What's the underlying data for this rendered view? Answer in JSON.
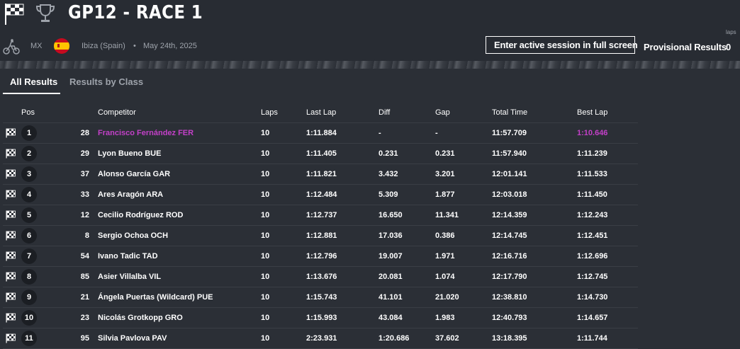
{
  "header": {
    "title": "GP12 - RACE 1",
    "discipline": "MX",
    "location": "Ibiza (Spain)",
    "separator": "•",
    "date": "May 24th, 2025",
    "fullscreen_label": "Enter active session in full screen",
    "provisional_label": "Provisional Results",
    "laps_label": "laps",
    "laps_value": "0"
  },
  "tabs": [
    {
      "label": "All Results",
      "active": true
    },
    {
      "label": "Results by Class",
      "active": false
    }
  ],
  "columns": {
    "pos": "Pos",
    "competitor": "Competitor",
    "laps": "Laps",
    "last_lap": "Last Lap",
    "diff": "Diff",
    "gap": "Gap",
    "total_time": "Total Time",
    "best_lap": "Best Lap"
  },
  "colors": {
    "background": "#2b2f36",
    "highlight": "#c340c8"
  },
  "rows": [
    {
      "pos": "1",
      "num": "28",
      "competitor": "Francisco Fernández FER",
      "laps": "10",
      "last_lap": "1:11.884",
      "diff": "-",
      "gap": "-",
      "total": "11:57.709",
      "best": "1:10.646",
      "highlight": true
    },
    {
      "pos": "2",
      "num": "29",
      "competitor": "Lyon Bueno BUE",
      "laps": "10",
      "last_lap": "1:11.405",
      "diff": "0.231",
      "gap": "0.231",
      "total": "11:57.940",
      "best": "1:11.239"
    },
    {
      "pos": "3",
      "num": "37",
      "competitor": "Alonso García GAR",
      "laps": "10",
      "last_lap": "1:11.821",
      "diff": "3.432",
      "gap": "3.201",
      "total": "12:01.141",
      "best": "1:11.533"
    },
    {
      "pos": "4",
      "num": "33",
      "competitor": "Ares Aragón ARA",
      "laps": "10",
      "last_lap": "1:12.484",
      "diff": "5.309",
      "gap": "1.877",
      "total": "12:03.018",
      "best": "1:11.450"
    },
    {
      "pos": "5",
      "num": "12",
      "competitor": "Cecilio Rodríguez ROD",
      "laps": "10",
      "last_lap": "1:12.737",
      "diff": "16.650",
      "gap": "11.341",
      "total": "12:14.359",
      "best": "1:12.243"
    },
    {
      "pos": "6",
      "num": "8",
      "competitor": "Sergio Ochoa OCH",
      "laps": "10",
      "last_lap": "1:12.881",
      "diff": "17.036",
      "gap": "0.386",
      "total": "12:14.745",
      "best": "1:12.451"
    },
    {
      "pos": "7",
      "num": "54",
      "competitor": "Ivano Tadic TAD",
      "laps": "10",
      "last_lap": "1:12.796",
      "diff": "19.007",
      "gap": "1.971",
      "total": "12:16.716",
      "best": "1:12.696"
    },
    {
      "pos": "8",
      "num": "85",
      "competitor": "Asier Villalba VIL",
      "laps": "10",
      "last_lap": "1:13.676",
      "diff": "20.081",
      "gap": "1.074",
      "total": "12:17.790",
      "best": "1:12.745"
    },
    {
      "pos": "9",
      "num": "21",
      "competitor": "Ángela Puertas (Wildcard) PUE",
      "laps": "10",
      "last_lap": "1:15.743",
      "diff": "41.101",
      "gap": "21.020",
      "total": "12:38.810",
      "best": "1:14.730"
    },
    {
      "pos": "10",
      "num": "23",
      "competitor": "Nicolás Grotkopp GRO",
      "laps": "10",
      "last_lap": "1:15.993",
      "diff": "43.084",
      "gap": "1.983",
      "total": "12:40.793",
      "best": "1:14.657"
    },
    {
      "pos": "11",
      "num": "95",
      "competitor": "Silvia Pavlova PAV",
      "laps": "10",
      "last_lap": "2:23.931",
      "diff": "1:20.686",
      "gap": "37.602",
      "total": "13:18.395",
      "best": "1:11.744"
    }
  ]
}
